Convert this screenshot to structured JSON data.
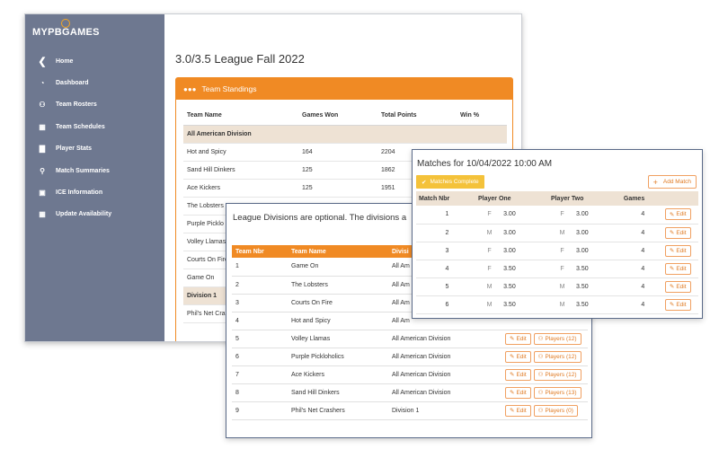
{
  "app": {
    "logo": "MYPBGAMES",
    "nav": [
      {
        "label": "Home",
        "icon": "chevron-left-icon"
      },
      {
        "label": "Dashboard",
        "icon": "tachometer-icon"
      },
      {
        "label": "Team Rosters",
        "icon": "users-icon"
      },
      {
        "label": "Team Schedules",
        "icon": "calendar-icon"
      },
      {
        "label": "Player Stats",
        "icon": "podium-icon"
      },
      {
        "label": "Match Summaries",
        "icon": "search-icon"
      },
      {
        "label": "ICE Information",
        "icon": "id-card-icon"
      },
      {
        "label": "Update Availability",
        "icon": "calendar-check-icon"
      }
    ],
    "page_title": "3.0/3.5 League Fall 2022"
  },
  "standings": {
    "title": "Team Standings",
    "headers": {
      "team": "Team Name",
      "games": "Games Won",
      "points": "Total Points",
      "win": "Win %"
    },
    "rows": [
      {
        "division": "All American Division"
      },
      {
        "team": "Hot and Spicy",
        "games": "164",
        "points": "2204",
        "win": "66 %"
      },
      {
        "team": "Sand Hill Dinkers",
        "games": "125",
        "points": "1862",
        "win": ""
      },
      {
        "team": "Ace Kickers",
        "games": "125",
        "points": "1951",
        "win": ""
      },
      {
        "team": "The Lobsters",
        "games": "111",
        "points": "1789",
        "win": ""
      },
      {
        "team": "Purple Picklo",
        "games": "",
        "points": "",
        "win": ""
      },
      {
        "team": "Volley Llamas",
        "games": "",
        "points": "",
        "win": ""
      },
      {
        "team": "Courts On Fire",
        "games": "",
        "points": "",
        "win": ""
      },
      {
        "team": "Game On",
        "games": "",
        "points": "",
        "win": ""
      },
      {
        "division": "Division 1"
      },
      {
        "team": "Phil's Net Cra",
        "games": "",
        "points": "",
        "win": ""
      }
    ]
  },
  "divisions": {
    "note": "League Divisions are optional. The divisions a",
    "headers": {
      "nbr": "Team Nbr",
      "name": "Team Name",
      "division": "Divisi"
    },
    "edit_label": "Edit",
    "rows": [
      {
        "nbr": "1",
        "name": "Game On",
        "division": "All Am",
        "players": ""
      },
      {
        "nbr": "2",
        "name": "The Lobsters",
        "division": "All Am",
        "players": ""
      },
      {
        "nbr": "3",
        "name": "Courts On Fire",
        "division": "All Am",
        "players": ""
      },
      {
        "nbr": "4",
        "name": "Hot and Spicy",
        "division": "All Am",
        "players": ""
      },
      {
        "nbr": "5",
        "name": "Volley Llamas",
        "division": "All American Division",
        "players": "Players (12)"
      },
      {
        "nbr": "6",
        "name": "Purple Pickloholics",
        "division": "All American Division",
        "players": "Players (12)"
      },
      {
        "nbr": "7",
        "name": "Ace Kickers",
        "division": "All American Division",
        "players": "Players (12)"
      },
      {
        "nbr": "8",
        "name": "Sand Hill Dinkers",
        "division": "All American Division",
        "players": "Players (13)"
      },
      {
        "nbr": "9",
        "name": "Phil's Net Crashers",
        "division": "Division 1",
        "players": "Players (0)"
      }
    ]
  },
  "matches": {
    "title": "Matches for 10/04/2022 10:00 AM",
    "complete_label": "Matches Complete",
    "add_label": "Add Match",
    "headers": {
      "nbr": "Match Nbr",
      "p1": "Player One",
      "p2": "Player Two",
      "games": "Games"
    },
    "edit_label": "Edit",
    "rows": [
      {
        "nbr": "1",
        "g1": "F",
        "r1": "3.00",
        "g2": "F",
        "r2": "3.00",
        "games": "4"
      },
      {
        "nbr": "2",
        "g1": "M",
        "r1": "3.00",
        "g2": "M",
        "r2": "3.00",
        "games": "4"
      },
      {
        "nbr": "3",
        "g1": "F",
        "r1": "3.00",
        "g2": "F",
        "r2": "3.00",
        "games": "4"
      },
      {
        "nbr": "4",
        "g1": "F",
        "r1": "3.50",
        "g2": "F",
        "r2": "3.50",
        "games": "4"
      },
      {
        "nbr": "5",
        "g1": "M",
        "r1": "3.50",
        "g2": "M",
        "r2": "3.50",
        "games": "4"
      },
      {
        "nbr": "6",
        "g1": "M",
        "r1": "3.50",
        "g2": "M",
        "r2": "3.50",
        "games": "4"
      }
    ]
  },
  "colors": {
    "accent": "#f08a24",
    "sidebar": "#6e7890",
    "warning": "#f4c23a",
    "frame": "#5a6a88"
  }
}
